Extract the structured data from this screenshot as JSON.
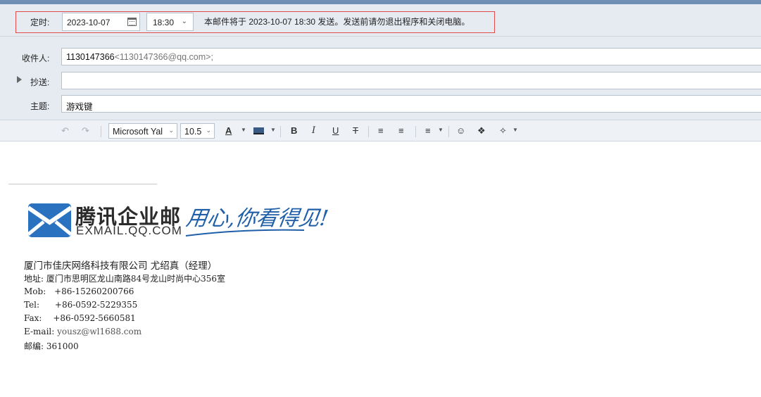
{
  "schedule": {
    "label": "定时:",
    "date": "2023-10-07",
    "time": "18:30",
    "note": "本邮件将于 2023-10-07 18:30 发送。发送前请勿退出程序和关闭电脑。"
  },
  "fields": {
    "to_label": "收件人:",
    "to_value": "1130147366",
    "to_address": "<1130147366@qq.com>;",
    "cc_label": "抄送:",
    "cc_value": "",
    "subject_label": "主题:",
    "subject_value": "游戏键"
  },
  "toolbar": {
    "font_family": "Microsoft Yal",
    "font_size": "10.5",
    "icons": [
      "undo-icon",
      "redo-icon",
      "font-color-icon",
      "highlight-icon",
      "bold-icon",
      "italic-icon",
      "underline-icon",
      "strikethrough-icon",
      "bullet-list-icon",
      "numbered-list-icon",
      "align-icon",
      "emoji-icon",
      "format-painter-icon",
      "magic-wand-icon"
    ]
  },
  "signature": {
    "logo_cn": "腾讯企业邮",
    "logo_en": "EXMAIL.QQ.COM",
    "slogan": "用心,你看得见!",
    "company_line": "厦门市佳庆网络科技有限公司 尤绍真（经理）",
    "address": "地址: 厦门市思明区龙山南路84号龙山时尚中心356室",
    "mob_label": "Mob:",
    "mob": "+86-15260200766",
    "tel_label": "Tel:",
    "tel": "+86-0592-5229355",
    "fax_label": "Fax:",
    "fax": "+86-0592-5660581",
    "email_label": "E-mail:",
    "email": "yousz@wl1688.com",
    "postcode_label": "邮编:",
    "postcode": "361000"
  },
  "colors": {
    "header_bg": "#e6ebf1",
    "highlight_border": "#e04a4a",
    "brand_blue": "#1f5fa8"
  }
}
